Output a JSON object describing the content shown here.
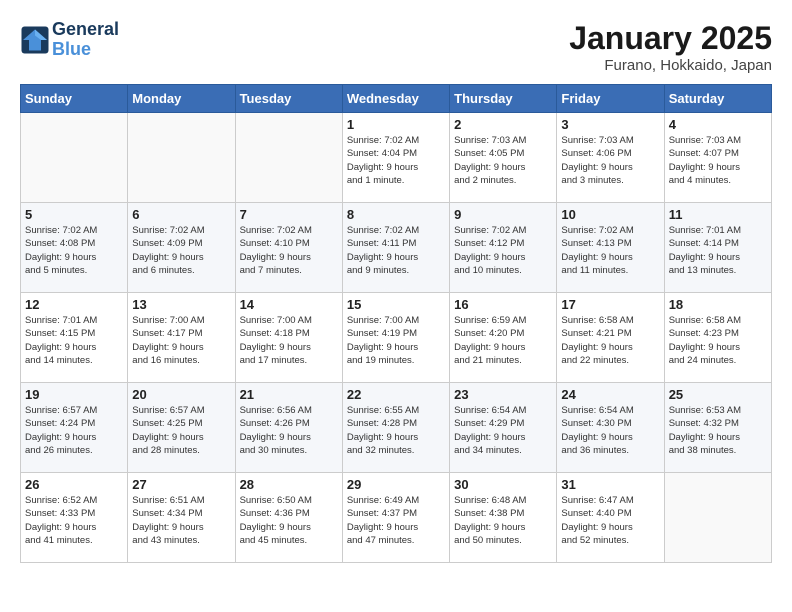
{
  "header": {
    "logo_line1": "General",
    "logo_line2": "Blue",
    "month_year": "January 2025",
    "location": "Furano, Hokkaido, Japan"
  },
  "weekdays": [
    "Sunday",
    "Monday",
    "Tuesday",
    "Wednesday",
    "Thursday",
    "Friday",
    "Saturday"
  ],
  "weeks": [
    [
      {
        "day": "",
        "info": ""
      },
      {
        "day": "",
        "info": ""
      },
      {
        "day": "",
        "info": ""
      },
      {
        "day": "1",
        "info": "Sunrise: 7:02 AM\nSunset: 4:04 PM\nDaylight: 9 hours\nand 1 minute."
      },
      {
        "day": "2",
        "info": "Sunrise: 7:03 AM\nSunset: 4:05 PM\nDaylight: 9 hours\nand 2 minutes."
      },
      {
        "day": "3",
        "info": "Sunrise: 7:03 AM\nSunset: 4:06 PM\nDaylight: 9 hours\nand 3 minutes."
      },
      {
        "day": "4",
        "info": "Sunrise: 7:03 AM\nSunset: 4:07 PM\nDaylight: 9 hours\nand 4 minutes."
      }
    ],
    [
      {
        "day": "5",
        "info": "Sunrise: 7:02 AM\nSunset: 4:08 PM\nDaylight: 9 hours\nand 5 minutes."
      },
      {
        "day": "6",
        "info": "Sunrise: 7:02 AM\nSunset: 4:09 PM\nDaylight: 9 hours\nand 6 minutes."
      },
      {
        "day": "7",
        "info": "Sunrise: 7:02 AM\nSunset: 4:10 PM\nDaylight: 9 hours\nand 7 minutes."
      },
      {
        "day": "8",
        "info": "Sunrise: 7:02 AM\nSunset: 4:11 PM\nDaylight: 9 hours\nand 9 minutes."
      },
      {
        "day": "9",
        "info": "Sunrise: 7:02 AM\nSunset: 4:12 PM\nDaylight: 9 hours\nand 10 minutes."
      },
      {
        "day": "10",
        "info": "Sunrise: 7:02 AM\nSunset: 4:13 PM\nDaylight: 9 hours\nand 11 minutes."
      },
      {
        "day": "11",
        "info": "Sunrise: 7:01 AM\nSunset: 4:14 PM\nDaylight: 9 hours\nand 13 minutes."
      }
    ],
    [
      {
        "day": "12",
        "info": "Sunrise: 7:01 AM\nSunset: 4:15 PM\nDaylight: 9 hours\nand 14 minutes."
      },
      {
        "day": "13",
        "info": "Sunrise: 7:00 AM\nSunset: 4:17 PM\nDaylight: 9 hours\nand 16 minutes."
      },
      {
        "day": "14",
        "info": "Sunrise: 7:00 AM\nSunset: 4:18 PM\nDaylight: 9 hours\nand 17 minutes."
      },
      {
        "day": "15",
        "info": "Sunrise: 7:00 AM\nSunset: 4:19 PM\nDaylight: 9 hours\nand 19 minutes."
      },
      {
        "day": "16",
        "info": "Sunrise: 6:59 AM\nSunset: 4:20 PM\nDaylight: 9 hours\nand 21 minutes."
      },
      {
        "day": "17",
        "info": "Sunrise: 6:58 AM\nSunset: 4:21 PM\nDaylight: 9 hours\nand 22 minutes."
      },
      {
        "day": "18",
        "info": "Sunrise: 6:58 AM\nSunset: 4:23 PM\nDaylight: 9 hours\nand 24 minutes."
      }
    ],
    [
      {
        "day": "19",
        "info": "Sunrise: 6:57 AM\nSunset: 4:24 PM\nDaylight: 9 hours\nand 26 minutes."
      },
      {
        "day": "20",
        "info": "Sunrise: 6:57 AM\nSunset: 4:25 PM\nDaylight: 9 hours\nand 28 minutes."
      },
      {
        "day": "21",
        "info": "Sunrise: 6:56 AM\nSunset: 4:26 PM\nDaylight: 9 hours\nand 30 minutes."
      },
      {
        "day": "22",
        "info": "Sunrise: 6:55 AM\nSunset: 4:28 PM\nDaylight: 9 hours\nand 32 minutes."
      },
      {
        "day": "23",
        "info": "Sunrise: 6:54 AM\nSunset: 4:29 PM\nDaylight: 9 hours\nand 34 minutes."
      },
      {
        "day": "24",
        "info": "Sunrise: 6:54 AM\nSunset: 4:30 PM\nDaylight: 9 hours\nand 36 minutes."
      },
      {
        "day": "25",
        "info": "Sunrise: 6:53 AM\nSunset: 4:32 PM\nDaylight: 9 hours\nand 38 minutes."
      }
    ],
    [
      {
        "day": "26",
        "info": "Sunrise: 6:52 AM\nSunset: 4:33 PM\nDaylight: 9 hours\nand 41 minutes."
      },
      {
        "day": "27",
        "info": "Sunrise: 6:51 AM\nSunset: 4:34 PM\nDaylight: 9 hours\nand 43 minutes."
      },
      {
        "day": "28",
        "info": "Sunrise: 6:50 AM\nSunset: 4:36 PM\nDaylight: 9 hours\nand 45 minutes."
      },
      {
        "day": "29",
        "info": "Sunrise: 6:49 AM\nSunset: 4:37 PM\nDaylight: 9 hours\nand 47 minutes."
      },
      {
        "day": "30",
        "info": "Sunrise: 6:48 AM\nSunset: 4:38 PM\nDaylight: 9 hours\nand 50 minutes."
      },
      {
        "day": "31",
        "info": "Sunrise: 6:47 AM\nSunset: 4:40 PM\nDaylight: 9 hours\nand 52 minutes."
      },
      {
        "day": "",
        "info": ""
      }
    ]
  ]
}
